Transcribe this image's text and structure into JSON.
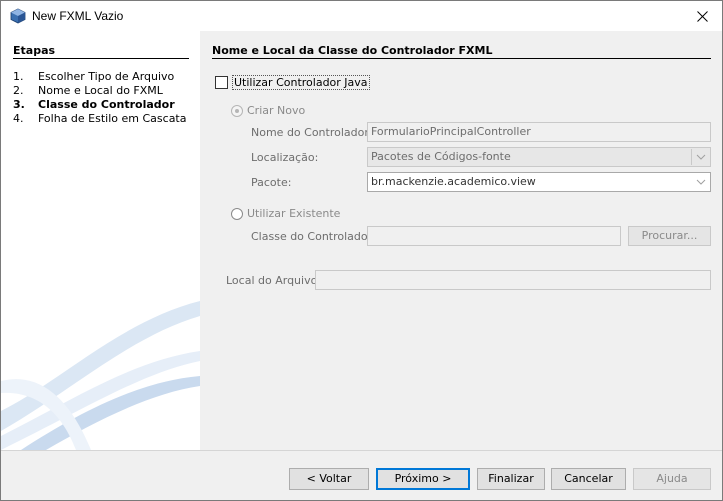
{
  "window": {
    "title": "New FXML Vazio"
  },
  "steps": {
    "heading": "Etapas",
    "items": [
      {
        "num": "1.",
        "label": "Escolher Tipo de Arquivo"
      },
      {
        "num": "2.",
        "label": "Nome e Local do FXML"
      },
      {
        "num": "3.",
        "label": "Classe do Controlador"
      },
      {
        "num": "4.",
        "label": "Folha de Estilo em Cascata"
      }
    ],
    "current_index": 2
  },
  "main": {
    "title": "Nome e Local da Classe do Controlador FXML",
    "use_controller": {
      "label": "Utilizar Controlador Java",
      "checked": false
    },
    "create_new": {
      "label": "Criar Novo",
      "selected": true
    },
    "controller_name": {
      "label": "Nome do Controlador:",
      "value": "FormularioPrincipalController"
    },
    "location": {
      "label": "Localização:",
      "value": "Pacotes de Códigos-fonte"
    },
    "package": {
      "label": "Pacote:",
      "value": "br.mackenzie.academico.view"
    },
    "use_existing": {
      "label": "Utilizar Existente",
      "selected": false
    },
    "controller_class": {
      "label": "Classe do Controlador:",
      "value": ""
    },
    "browse_label": "Procurar...",
    "file_location": {
      "label": "Local do Arquivo:",
      "value": ""
    }
  },
  "footer": {
    "back_label": "< Voltar",
    "next_label": "Próximo >",
    "finish_label": "Finalizar",
    "cancel_label": "Cancelar",
    "help_label": "Ajuda"
  }
}
